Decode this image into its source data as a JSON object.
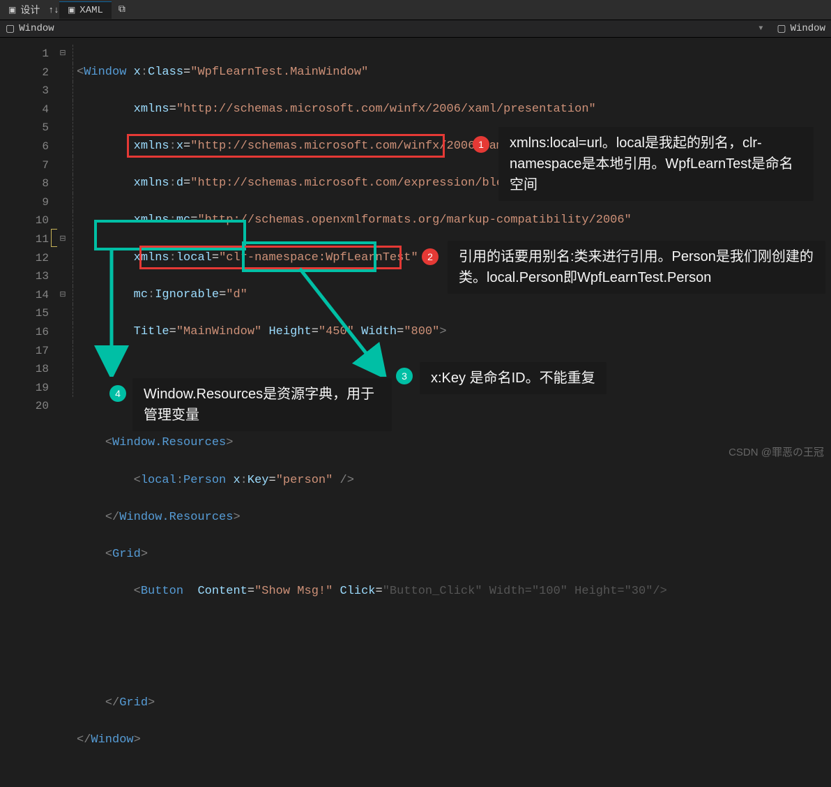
{
  "tabs": {
    "design": "设计",
    "xaml": "XAML"
  },
  "breadcrumb": {
    "left": "Window",
    "right": "Window"
  },
  "lines": [
    "1",
    "2",
    "3",
    "4",
    "5",
    "6",
    "7",
    "8",
    "9",
    "10",
    "11",
    "12",
    "13",
    "14",
    "15",
    "16",
    "17",
    "18",
    "19",
    "20"
  ],
  "code": {
    "l1": {
      "open": "<",
      "tag": "Window ",
      "a1": "x",
      "c1": ":",
      "a2": "Class",
      "eq": "=",
      "v": "\"WpfLearnTest.MainWindow\""
    },
    "l2": {
      "a": "xmlns",
      "eq": "=",
      "v": "\"http://schemas.microsoft.com/winfx/2006/xaml/presentation\""
    },
    "l3": {
      "a1": "xmlns",
      "c": ":",
      "a2": "x",
      "eq": "=",
      "v": "\"http://schemas.microsoft.com/winfx/2006/xaml\""
    },
    "l4": {
      "a1": "xmlns",
      "c": ":",
      "a2": "d",
      "eq": "=",
      "v": "\"http://schemas.microsoft.com/expression/blend/2008\""
    },
    "l5": {
      "a1": "xmlns",
      "c": ":",
      "a2": "mc",
      "eq": "=",
      "v": "\"http://schemas.openxmlformats.org/markup-compatibility/2006\""
    },
    "l6": {
      "a1": "xmlns",
      "c": ":",
      "a2": "local",
      "eq": "=",
      "v": "\"clr-namespace:WpfLearnTest\""
    },
    "l7": {
      "a1": "mc",
      "c": ":",
      "a2": "Ignorable",
      "eq": "=",
      "v": "\"d\""
    },
    "l8": {
      "a1": "Title",
      "eq1": "=",
      "v1": "\"MainWindow\"",
      "a2": " Height",
      "eq2": "=",
      "v2": "\"450\"",
      "a3": " Width",
      "eq3": "=",
      "v3": "\"800\"",
      "close": ">"
    },
    "l11a": "<",
    "l11b": "Window.Resources",
    "l11c": ">",
    "l12": {
      "open": "<",
      "t1": "local",
      "c": ":",
      "t2": "Person ",
      "a1": "x",
      "c2": ":",
      "a2": "Key",
      "eq": "=",
      "v": "\"person\"",
      "close": " />"
    },
    "l13a": "</",
    "l13b": "Window.Resources",
    "l13c": ">",
    "l14a": "<",
    "l14b": "Grid",
    "l14c": ">",
    "l15": {
      "open": "<",
      "tag": "Button  ",
      "a1": "Content",
      "eq1": "=",
      "v1": "\"Show Msg!\"",
      "a2": " Click",
      "eq2": "=",
      "v2": "\"Button_Click\"",
      "a3": " Width",
      "eq3": "=",
      "v3": "\"100\"",
      "a4": " Height",
      "eq4": "=",
      "v4": "\"30\"",
      "close": "/>"
    },
    "l18a": "</",
    "l18b": "Grid",
    "l18c": ">",
    "l19a": "</",
    "l19b": "Window",
    "l19c": ">"
  },
  "annotations": {
    "n1": "xmlns:local=url。local是我起的别名，clr-namespace是本地引用。WpfLearnTest是命名空间",
    "n2": "引用的话要用别名:类来进行引用。Person是我们刚创建的类。local.Person即WpfLearnTest.Person",
    "n3": "x:Key 是命名ID。不能重复",
    "n4": "Window.Resources是资源字典，用于管理变量",
    "c1": "1",
    "c2": "2",
    "c3": "3",
    "c4": "4"
  },
  "watermark": "CSDN @罪恶の王冠"
}
